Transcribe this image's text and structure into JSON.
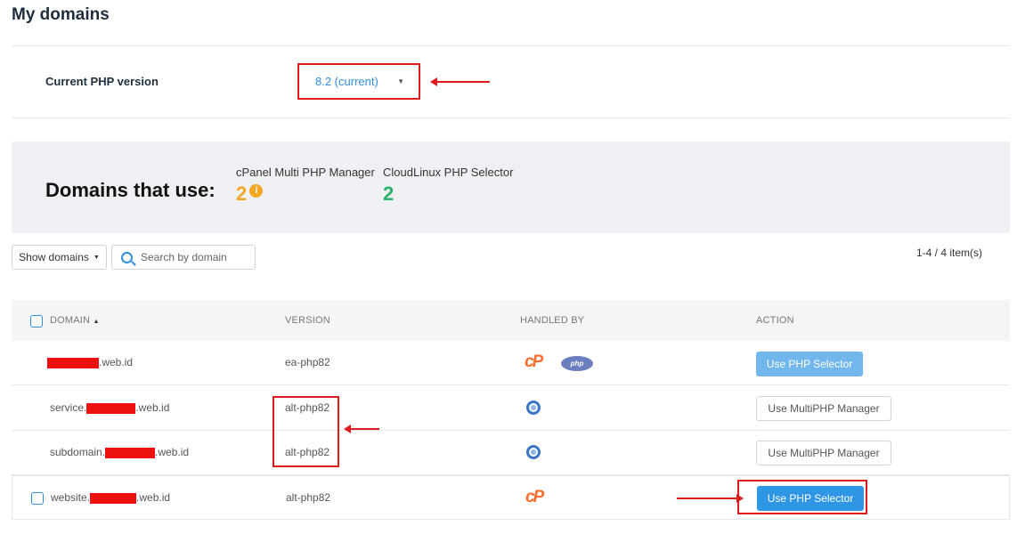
{
  "page": {
    "title": "My domains"
  },
  "php_version": {
    "label": "Current PHP version",
    "selected": "8.2 (current)"
  },
  "stats": {
    "title": "Domains that use:",
    "multi_php": {
      "label": "cPanel Multi PHP Manager",
      "value": "2",
      "info_icon": "i"
    },
    "php_selector": {
      "label": "CloudLinux PHP Selector",
      "value": "2"
    }
  },
  "toolbar": {
    "show_domains_label": "Show domains",
    "search_placeholder": "Search by domain",
    "item_count": "1-4 / 4 item(s)"
  },
  "table": {
    "columns": {
      "domain": "DOMAIN",
      "version": "VERSION",
      "handled_by": "HANDLED BY",
      "action": "ACTION"
    },
    "sort_indicator": "▲",
    "rows": [
      {
        "domain_prefix": "",
        "domain_suffix": ".web.id",
        "version": "ea-php82",
        "handlers": [
          "cpanel-icon",
          "php-icon"
        ],
        "action": "Use PHP Selector"
      },
      {
        "domain_prefix": "service.",
        "domain_suffix": ".web.id",
        "version": "alt-php82",
        "handlers": [
          "cloudlinux-icon"
        ],
        "action": "Use MultiPHP Manager"
      },
      {
        "domain_prefix": "subdomain.",
        "domain_suffix": ".web.id",
        "version": "alt-php82",
        "handlers": [
          "cloudlinux-icon"
        ],
        "action": "Use MultiPHP Manager"
      },
      {
        "domain_prefix": "website.",
        "domain_suffix": ".web.id",
        "version": "alt-php82",
        "handlers": [
          "cpanel-icon"
        ],
        "action": "Use PHP Selector"
      }
    ]
  },
  "logos": {
    "cpanel": "cP",
    "php": "php"
  },
  "colors": {
    "accent": "#2f96e6",
    "annotation": "#e01b1b",
    "orange": "#f5a623",
    "green": "#27b36a"
  }
}
